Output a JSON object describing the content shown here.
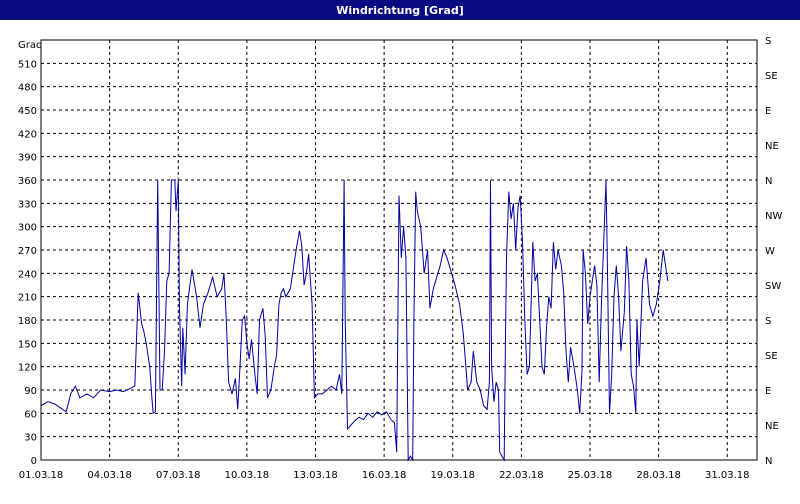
{
  "window": {
    "title": "Windrichtung [Grad]"
  },
  "chart_data": {
    "type": "line",
    "title": "Windrichtung [Grad]",
    "ylabel": "Grad",
    "xlabel": "",
    "ylim": [
      0,
      540
    ],
    "yticks": [
      0,
      30,
      60,
      90,
      120,
      150,
      180,
      210,
      240,
      270,
      300,
      330,
      360,
      390,
      420,
      450,
      480,
      510
    ],
    "xtick_labels": [
      "01.03.18",
      "04.03.18",
      "07.03.18",
      "10.03.18",
      "13.03.18",
      "16.03.18",
      "19.03.18",
      "22.03.18",
      "25.03.18",
      "28.03.18",
      "31.03.18"
    ],
    "xtick_days": [
      0,
      3,
      6,
      9,
      12,
      15,
      18,
      21,
      24,
      27,
      30
    ],
    "xlim_days": [
      0,
      31.3
    ],
    "right_axis": {
      "labels": [
        "N",
        "NE",
        "E",
        "SE",
        "S",
        "SW",
        "W",
        "NW",
        "N",
        "NE",
        "E",
        "SE",
        "S"
      ],
      "values": [
        0,
        45,
        90,
        135,
        180,
        225,
        270,
        315,
        360,
        405,
        450,
        495,
        540
      ]
    },
    "grid": true,
    "line_color": "#0000a0",
    "series": [
      {
        "values": [
          [
            0.0,
            70
          ],
          [
            0.3,
            75
          ],
          [
            0.6,
            72
          ],
          [
            0.9,
            66
          ],
          [
            1.1,
            62
          ],
          [
            1.3,
            85
          ],
          [
            1.5,
            95
          ],
          [
            1.7,
            80
          ],
          [
            2.0,
            85
          ],
          [
            2.3,
            80
          ],
          [
            2.6,
            90
          ],
          [
            3.0,
            88
          ],
          [
            3.3,
            90
          ],
          [
            3.6,
            88
          ],
          [
            3.9,
            92
          ],
          [
            4.1,
            95
          ],
          [
            4.25,
            215
          ],
          [
            4.4,
            175
          ],
          [
            4.5,
            165
          ],
          [
            4.6,
            150
          ],
          [
            4.75,
            120
          ],
          [
            4.85,
            80
          ],
          [
            4.9,
            60
          ],
          [
            5.0,
            62
          ],
          [
            5.1,
            360
          ],
          [
            5.2,
            90
          ],
          [
            5.3,
            90
          ],
          [
            5.4,
            140
          ],
          [
            5.5,
            230
          ],
          [
            5.6,
            240
          ],
          [
            5.7,
            360
          ],
          [
            5.85,
            360
          ],
          [
            5.9,
            320
          ],
          [
            6.0,
            360
          ],
          [
            6.05,
            200
          ],
          [
            6.15,
            95
          ],
          [
            6.2,
            170
          ],
          [
            6.3,
            110
          ],
          [
            6.4,
            200
          ],
          [
            6.6,
            245
          ],
          [
            6.8,
            210
          ],
          [
            6.95,
            170
          ],
          [
            7.1,
            200
          ],
          [
            7.3,
            215
          ],
          [
            7.5,
            235
          ],
          [
            7.7,
            210
          ],
          [
            7.9,
            220
          ],
          [
            8.0,
            240
          ],
          [
            8.1,
            180
          ],
          [
            8.2,
            100
          ],
          [
            8.35,
            85
          ],
          [
            8.5,
            105
          ],
          [
            8.6,
            65
          ],
          [
            8.7,
            120
          ],
          [
            8.8,
            180
          ],
          [
            8.9,
            185
          ],
          [
            9.0,
            150
          ],
          [
            9.1,
            130
          ],
          [
            9.2,
            155
          ],
          [
            9.35,
            110
          ],
          [
            9.45,
            85
          ],
          [
            9.55,
            180
          ],
          [
            9.7,
            195
          ],
          [
            9.8,
            160
          ],
          [
            9.9,
            80
          ],
          [
            10.05,
            90
          ],
          [
            10.2,
            120
          ],
          [
            10.3,
            135
          ],
          [
            10.4,
            200
          ],
          [
            10.5,
            215
          ],
          [
            10.6,
            220
          ],
          [
            10.7,
            210
          ],
          [
            10.9,
            220
          ],
          [
            11.05,
            250
          ],
          [
            11.15,
            270
          ],
          [
            11.3,
            295
          ],
          [
            11.4,
            275
          ],
          [
            11.5,
            225
          ],
          [
            11.6,
            240
          ],
          [
            11.7,
            265
          ],
          [
            11.85,
            200
          ],
          [
            11.95,
            80
          ],
          [
            12.1,
            85
          ],
          [
            12.3,
            85
          ],
          [
            12.5,
            90
          ],
          [
            12.7,
            95
          ],
          [
            12.9,
            90
          ],
          [
            13.05,
            110
          ],
          [
            13.15,
            85
          ],
          [
            13.25,
            360
          ],
          [
            13.3,
            180
          ],
          [
            13.4,
            40
          ],
          [
            13.55,
            45
          ],
          [
            13.7,
            50
          ],
          [
            13.9,
            55
          ],
          [
            14.1,
            52
          ],
          [
            14.3,
            60
          ],
          [
            14.5,
            55
          ],
          [
            14.7,
            62
          ],
          [
            14.9,
            58
          ],
          [
            15.1,
            62
          ],
          [
            15.3,
            52
          ],
          [
            15.45,
            48
          ],
          [
            15.55,
            10
          ],
          [
            15.65,
            340
          ],
          [
            15.75,
            260
          ],
          [
            15.85,
            300
          ],
          [
            15.95,
            260
          ],
          [
            16.05,
            0
          ],
          [
            16.15,
            5
          ],
          [
            16.25,
            0
          ],
          [
            16.3,
            180
          ],
          [
            16.38,
            345
          ],
          [
            16.45,
            320
          ],
          [
            16.6,
            300
          ],
          [
            16.75,
            240
          ],
          [
            16.9,
            270
          ],
          [
            17.0,
            195
          ],
          [
            17.15,
            220
          ],
          [
            17.3,
            235
          ],
          [
            17.45,
            250
          ],
          [
            17.6,
            270
          ],
          [
            17.75,
            260
          ],
          [
            17.95,
            240
          ],
          [
            18.1,
            225
          ],
          [
            18.3,
            200
          ],
          [
            18.45,
            165
          ],
          [
            18.55,
            130
          ],
          [
            18.65,
            90
          ],
          [
            18.8,
            100
          ],
          [
            18.9,
            140
          ],
          [
            19.05,
            100
          ],
          [
            19.2,
            90
          ],
          [
            19.35,
            70
          ],
          [
            19.5,
            65
          ],
          [
            19.6,
            100
          ],
          [
            19.65,
            360
          ],
          [
            19.7,
            120
          ],
          [
            19.8,
            75
          ],
          [
            19.9,
            100
          ],
          [
            20.0,
            90
          ],
          [
            20.05,
            10
          ],
          [
            20.15,
            5
          ],
          [
            20.25,
            0
          ],
          [
            20.3,
            150
          ],
          [
            20.35,
            260
          ],
          [
            20.45,
            345
          ],
          [
            20.55,
            310
          ],
          [
            20.65,
            330
          ],
          [
            20.75,
            270
          ],
          [
            20.85,
            325
          ],
          [
            20.95,
            340
          ],
          [
            21.05,
            280
          ],
          [
            21.15,
            180
          ],
          [
            21.25,
            110
          ],
          [
            21.35,
            120
          ],
          [
            21.5,
            280
          ],
          [
            21.6,
            230
          ],
          [
            21.7,
            240
          ],
          [
            21.8,
            180
          ],
          [
            21.9,
            120
          ],
          [
            22.0,
            110
          ],
          [
            22.1,
            170
          ],
          [
            22.2,
            210
          ],
          [
            22.3,
            195
          ],
          [
            22.4,
            280
          ],
          [
            22.5,
            245
          ],
          [
            22.6,
            270
          ],
          [
            22.75,
            250
          ],
          [
            22.85,
            215
          ],
          [
            22.95,
            140
          ],
          [
            23.05,
            100
          ],
          [
            23.15,
            145
          ],
          [
            23.3,
            120
          ],
          [
            23.45,
            90
          ],
          [
            23.55,
            60
          ],
          [
            23.65,
            115
          ],
          [
            23.7,
            270
          ],
          [
            23.8,
            240
          ],
          [
            23.9,
            175
          ],
          [
            24.0,
            210
          ],
          [
            24.1,
            230
          ],
          [
            24.2,
            250
          ],
          [
            24.3,
            225
          ],
          [
            24.4,
            100
          ],
          [
            24.5,
            200
          ],
          [
            24.6,
            280
          ],
          [
            24.7,
            360
          ],
          [
            24.75,
            270
          ],
          [
            24.85,
            60
          ],
          [
            24.95,
            110
          ],
          [
            25.05,
            210
          ],
          [
            25.15,
            250
          ],
          [
            25.25,
            210
          ],
          [
            25.35,
            140
          ],
          [
            25.5,
            190
          ],
          [
            25.6,
            275
          ],
          [
            25.7,
            230
          ],
          [
            25.8,
            110
          ],
          [
            25.9,
            95
          ],
          [
            26.0,
            60
          ],
          [
            26.05,
            180
          ],
          [
            26.15,
            120
          ],
          [
            26.3,
            230
          ],
          [
            26.45,
            260
          ],
          [
            26.6,
            200
          ],
          [
            26.75,
            185
          ],
          [
            26.9,
            200
          ],
          [
            27.05,
            230
          ],
          [
            27.2,
            270
          ],
          [
            27.4,
            230
          ]
        ]
      }
    ]
  }
}
